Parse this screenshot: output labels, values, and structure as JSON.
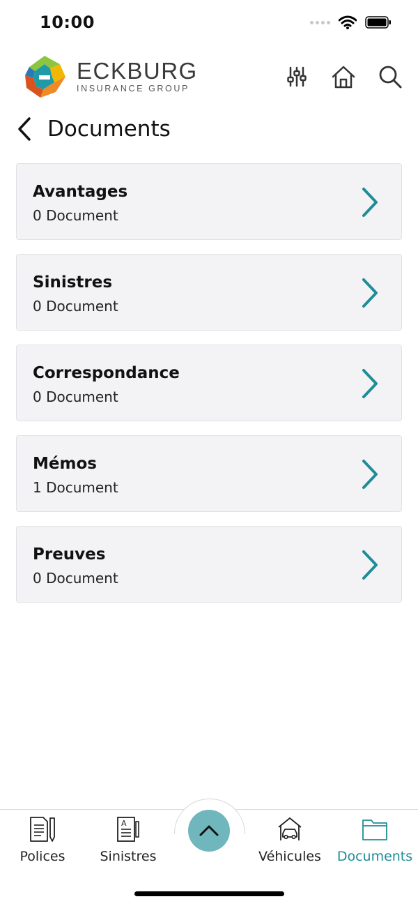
{
  "status_bar": {
    "time": "10:00"
  },
  "header": {
    "logo_name": "ECKBURG",
    "logo_subtitle": "INSURANCE GROUP",
    "icons": [
      "sliders-icon",
      "home-icon",
      "search-icon"
    ]
  },
  "page": {
    "title": "Documents"
  },
  "documents": [
    {
      "name": "Avantages",
      "count": "0 Document"
    },
    {
      "name": "Sinistres",
      "count": "0 Document"
    },
    {
      "name": "Correspondance",
      "count": "0 Document"
    },
    {
      "name": "Mémos",
      "count": "1 Document"
    },
    {
      "name": "Preuves",
      "count": "0 Document"
    }
  ],
  "tab_bar": {
    "tabs": [
      {
        "label": "Polices",
        "icon": "policy-document-icon"
      },
      {
        "label": "Sinistres",
        "icon": "claims-document-icon"
      },
      {
        "label": "Véhicules",
        "icon": "car-garage-icon"
      },
      {
        "label": "Documents",
        "icon": "folder-icon",
        "active": true
      }
    ],
    "fab_icon": "chevron-up-icon"
  },
  "colors": {
    "accent": "#1e8d96",
    "fab": "#6fb6bd",
    "card_background": "#f3f3f5"
  }
}
